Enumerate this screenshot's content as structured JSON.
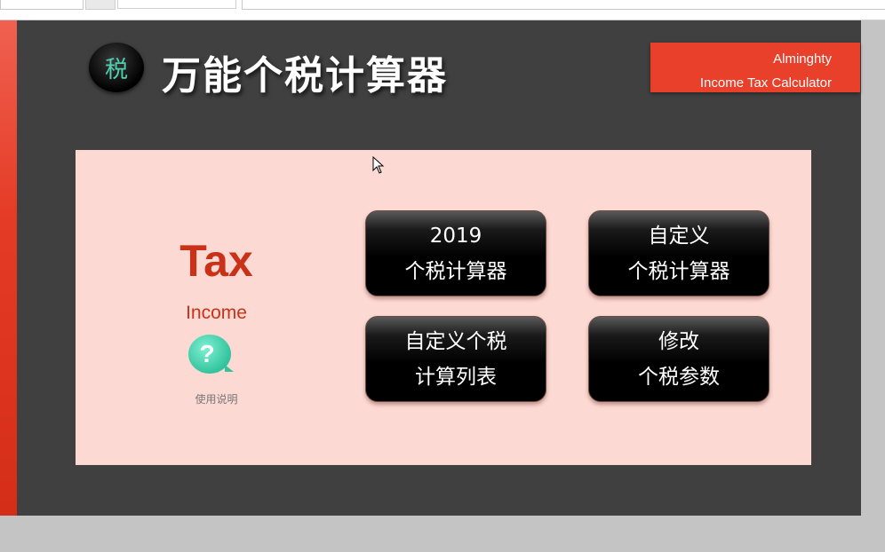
{
  "header": {
    "logo_char": "税",
    "title": "万能个税计算器",
    "brand_line1": "Alminghty",
    "brand_line2": "Income Tax Calculator"
  },
  "panel": {
    "tax_word": "Tax",
    "income_word": "Income",
    "help_glyph": "?",
    "help_label": "使用说明"
  },
  "buttons": [
    {
      "line1": "2019",
      "line2": "个税计算器"
    },
    {
      "line1": "自定义",
      "line2": "个税计算器"
    },
    {
      "line1": "自定义个税",
      "line2": "计算列表"
    },
    {
      "line1": "修改",
      "line2": "个税参数"
    }
  ],
  "colors": {
    "accent_red": "#e8402a",
    "panel_bg": "#fcd9d3",
    "sheet_bg": "#404040",
    "help_green": "#33c39d"
  },
  "icons": [
    "tax-logo-icon",
    "help-bubble-icon",
    "mouse-cursor-icon"
  ]
}
